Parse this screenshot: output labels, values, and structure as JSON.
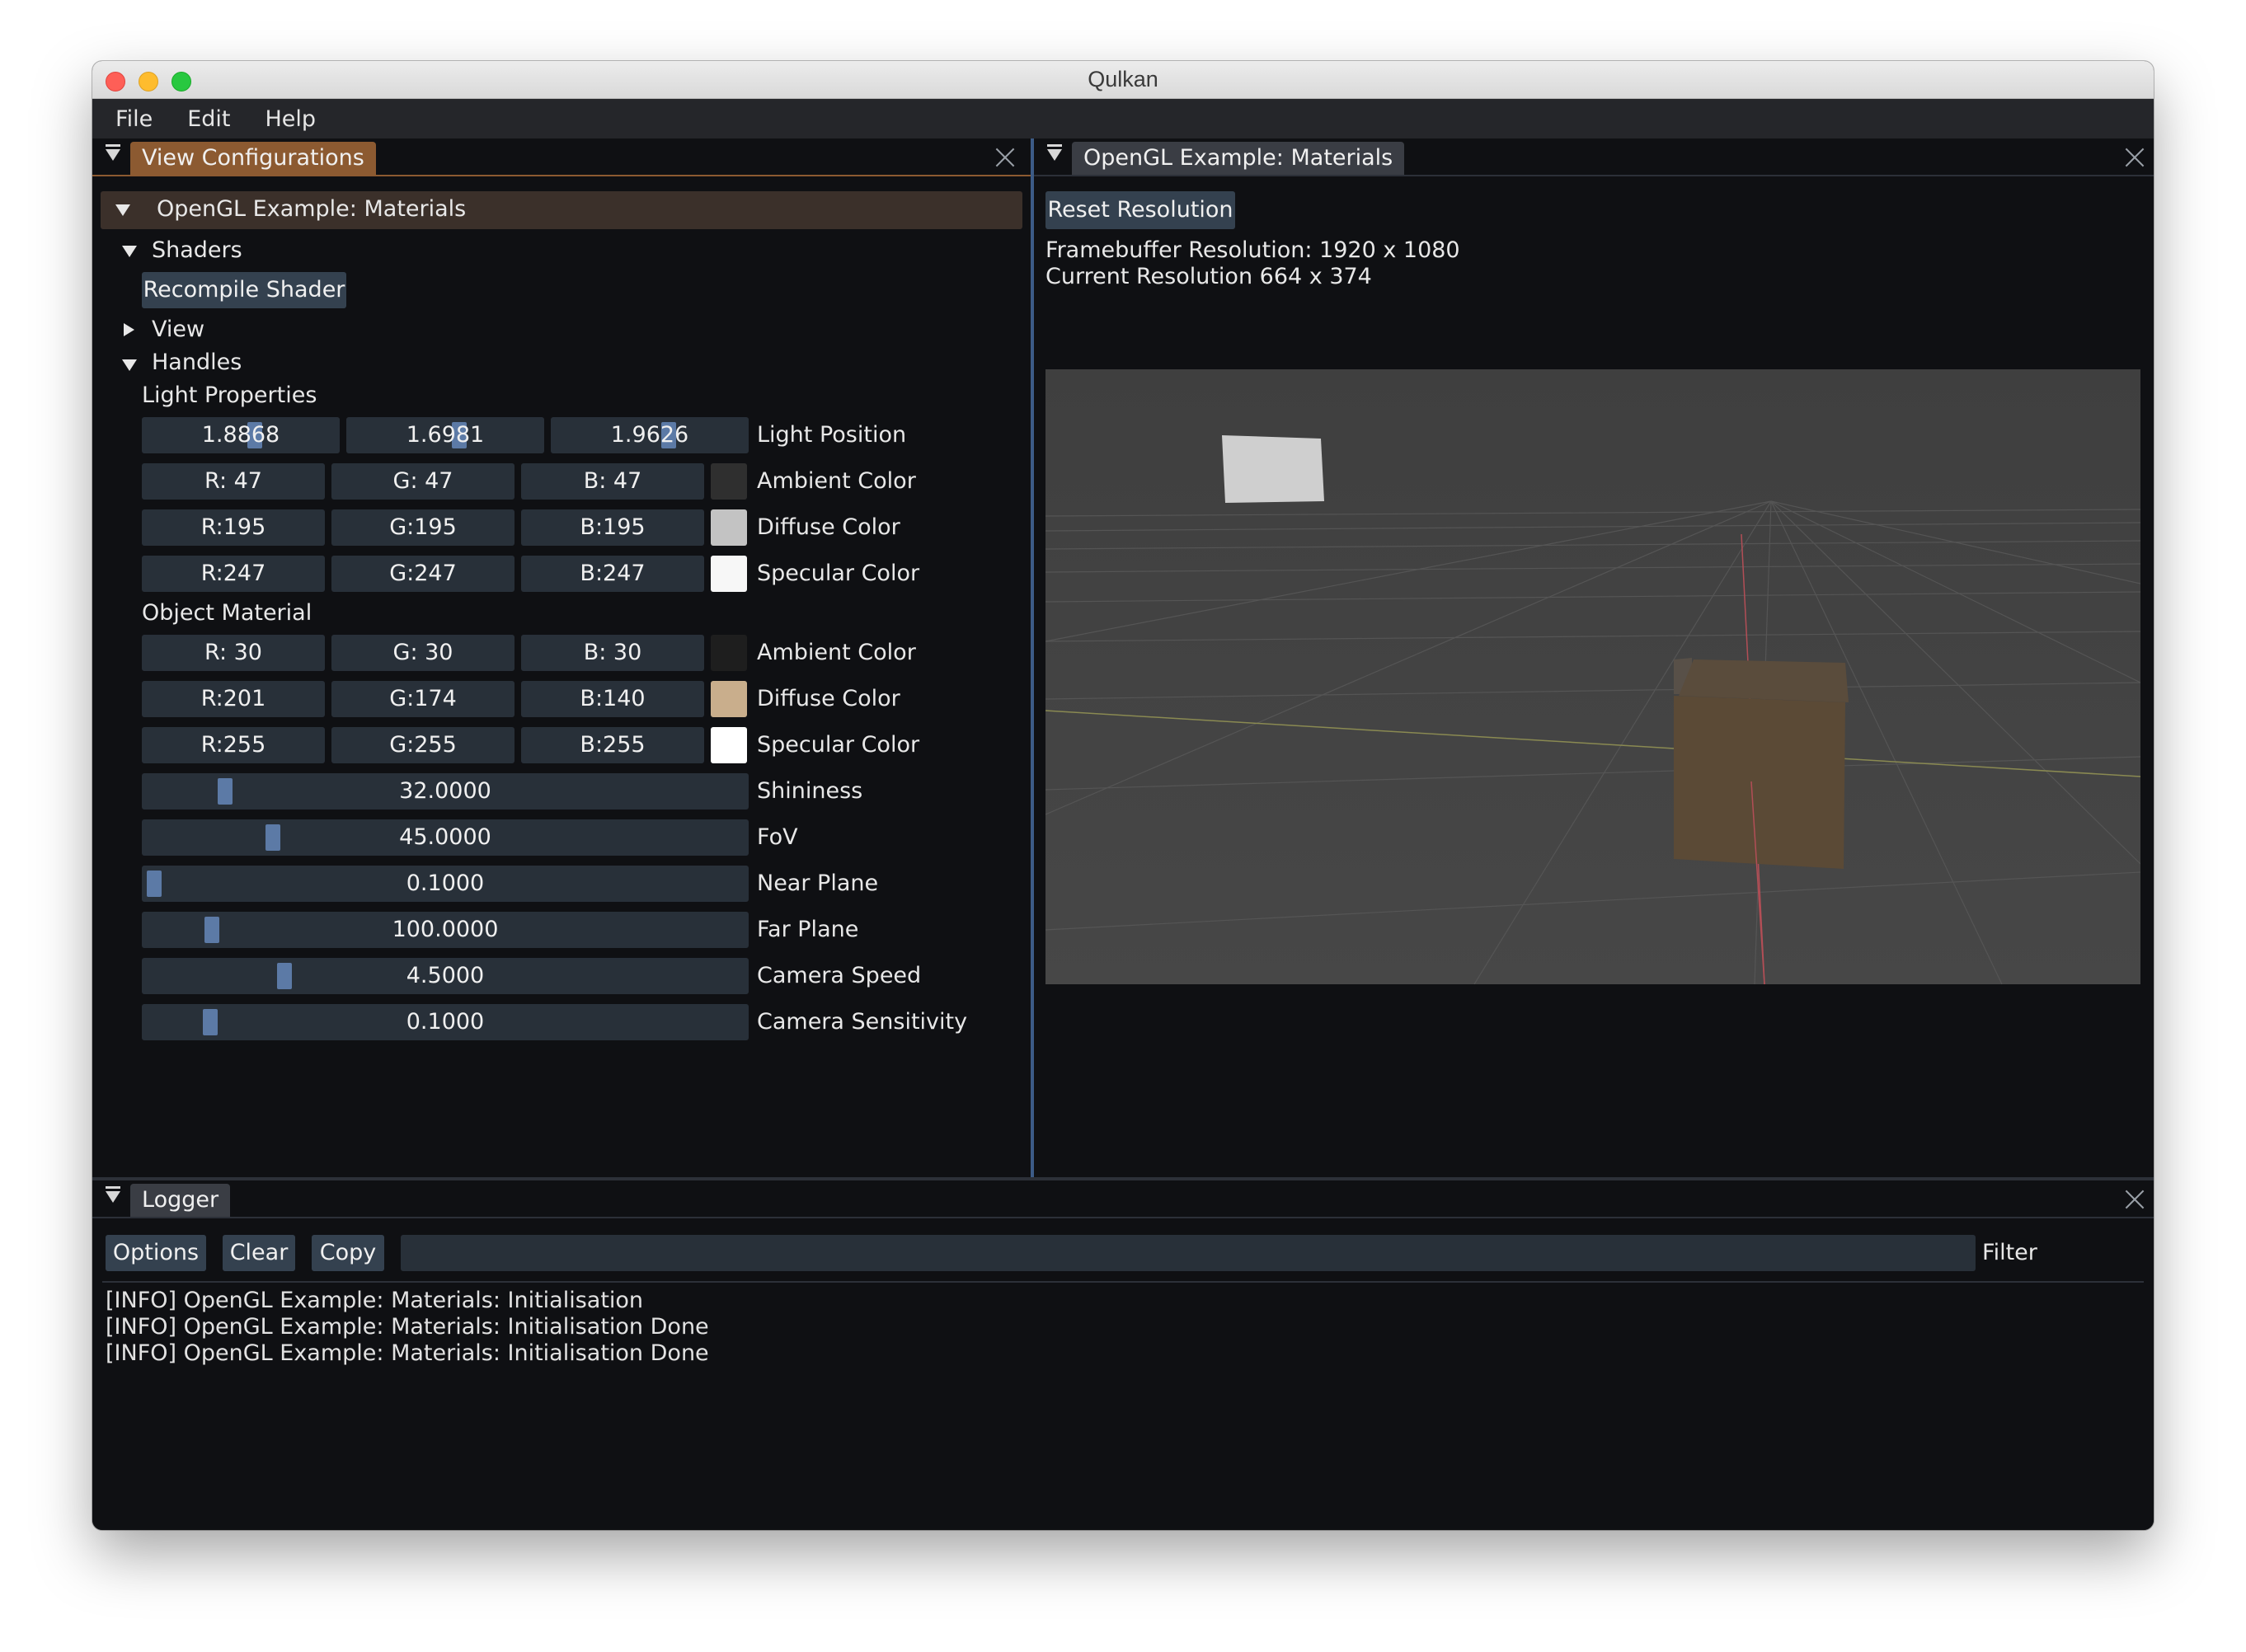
{
  "window": {
    "title": "Qulkan"
  },
  "menu": [
    "File",
    "Edit",
    "Help"
  ],
  "left_panel": {
    "tab": "View Configurations",
    "header": "OpenGL Example: Materials",
    "shaders": {
      "label": "Shaders",
      "button": "Recompile Shader"
    },
    "view_label": "View",
    "handles_label": "Handles",
    "light_properties": {
      "label": "Light Properties",
      "position": {
        "values": [
          "1.8868",
          "1.6981",
          "1.9626"
        ],
        "fractions": [
          0.57,
          0.57,
          0.59
        ],
        "label": "Light Position"
      },
      "ambient": {
        "r": "R: 47",
        "g": "G: 47",
        "b": "B: 47",
        "color": "#2f2f2f",
        "label": "Ambient Color"
      },
      "diffuse": {
        "r": "R:195",
        "g": "G:195",
        "b": "B:195",
        "color": "#c3c3c3",
        "label": "Diffuse Color"
      },
      "specular": {
        "r": "R:247",
        "g": "G:247",
        "b": "B:247",
        "color": "#f7f7f7",
        "label": "Specular Color"
      }
    },
    "object_material": {
      "label": "Object Material",
      "ambient": {
        "r": "R: 30",
        "g": "G: 30",
        "b": "B: 30",
        "color": "#1e1e1e",
        "label": "Ambient Color"
      },
      "diffuse": {
        "r": "R:201",
        "g": "G:174",
        "b": "B:140",
        "color": "#c9ae8c",
        "label": "Diffuse Color"
      },
      "specular": {
        "r": "R:255",
        "g": "G:255",
        "b": "B:255",
        "color": "#ffffff",
        "label": "Specular Color"
      }
    },
    "sliders": [
      {
        "value": "32.0000",
        "label": "Shininess",
        "fraction": 0.125
      },
      {
        "value": "45.0000",
        "label": "FoV",
        "fraction": 0.205
      },
      {
        "value": "0.1000",
        "label": "Near Plane",
        "fraction": 0.0
      },
      {
        "value": "100.0000",
        "label": "Far Plane",
        "fraction": 0.1
      },
      {
        "value": "4.5000",
        "label": "Camera Speed",
        "fraction": 0.225
      },
      {
        "value": "0.1000",
        "label": "Camera Sensitivity",
        "fraction": 0.1
      }
    ]
  },
  "right_panel": {
    "tab": "OpenGL Example: Materials",
    "reset_button": "Reset Resolution",
    "framebuffer": "Framebuffer Resolution: 1920 x 1080",
    "current": "Current Resolution 664 x 374"
  },
  "logger": {
    "tab": "Logger",
    "buttons": {
      "options": "Options",
      "clear": "Clear",
      "copy": "Copy"
    },
    "filter_label": "Filter",
    "filter_value": "",
    "lines": [
      "[INFO] OpenGL Example: Materials: Initialisation",
      "[INFO] OpenGL Example: Materials: Initialisation Done",
      "[INFO] OpenGL Example: Materials: Initialisation Done"
    ]
  },
  "colors": {
    "tab_active": "#8c5a31",
    "button": "#34414f",
    "field": "#283039",
    "grab": "#5c7aa6"
  }
}
